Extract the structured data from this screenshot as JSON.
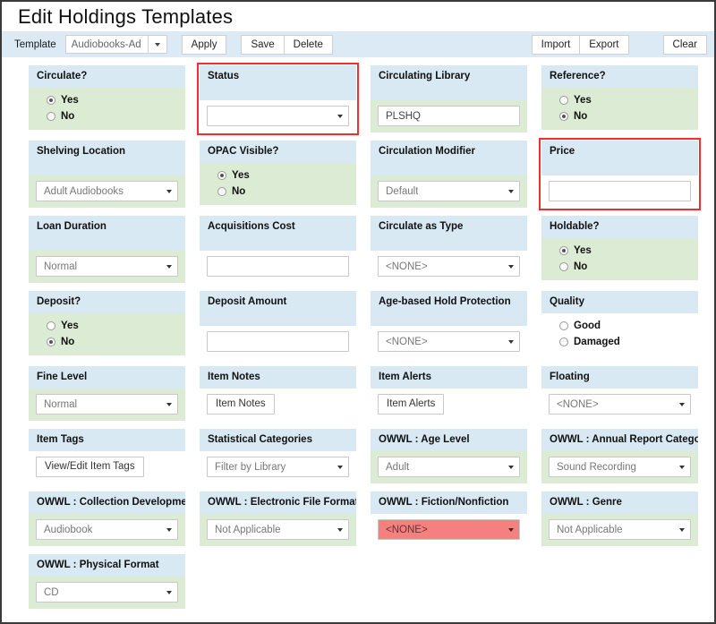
{
  "page": {
    "title": "Edit Holdings Templates"
  },
  "toolbar": {
    "template_label": "Template",
    "template_value": "Audiobooks-Ad",
    "template_caret_icon": "chevron-down-icon",
    "apply_label": "Apply",
    "save_label": "Save",
    "delete_label": "Delete",
    "import_label": "Import",
    "export_label": "Export",
    "clear_label": "Clear"
  },
  "highlight_color": "#f03030",
  "danger_color": "#f48080",
  "header_color": "#d8e9f3",
  "body_green": "#dcecd4",
  "rows": [
    [
      {
        "name": "circulate",
        "label": "Circulate?",
        "type": "radio",
        "body": "green",
        "highlight": false,
        "options": [
          {
            "label": "Yes",
            "selected": true
          },
          {
            "label": "No",
            "selected": false
          }
        ]
      },
      {
        "name": "status",
        "label": "Status",
        "type": "select",
        "body": "white",
        "highlight": true,
        "head_tall": true,
        "value": ""
      },
      {
        "name": "circulating-library",
        "label": "Circulating Library",
        "type": "text",
        "body": "green",
        "highlight": false,
        "head_tall": true,
        "value": "PLSHQ"
      },
      {
        "name": "reference",
        "label": "Reference?",
        "type": "radio",
        "body": "green",
        "highlight": false,
        "options": [
          {
            "label": "Yes",
            "selected": false
          },
          {
            "label": "No",
            "selected": true
          }
        ]
      }
    ],
    [
      {
        "name": "shelving-location",
        "label": "Shelving Location",
        "type": "select",
        "body": "green",
        "highlight": false,
        "head_tall": true,
        "value": "Adult Audiobooks"
      },
      {
        "name": "opac-visible",
        "label": "OPAC Visible?",
        "type": "radio",
        "body": "green",
        "highlight": false,
        "options": [
          {
            "label": "Yes",
            "selected": true
          },
          {
            "label": "No",
            "selected": false
          }
        ]
      },
      {
        "name": "circulation-modifier",
        "label": "Circulation Modifier",
        "type": "select",
        "body": "green",
        "highlight": false,
        "head_tall": true,
        "value": "Default"
      },
      {
        "name": "price",
        "label": "Price",
        "type": "text",
        "body": "white",
        "highlight": true,
        "head_tall": true,
        "value": ""
      }
    ],
    [
      {
        "name": "loan-duration",
        "label": "Loan Duration",
        "type": "select",
        "body": "green",
        "highlight": false,
        "head_tall": true,
        "value": "Normal"
      },
      {
        "name": "acquisitions-cost",
        "label": "Acquisitions Cost",
        "type": "text",
        "body": "white",
        "highlight": false,
        "head_tall": true,
        "value": ""
      },
      {
        "name": "circulate-as-type",
        "label": "Circulate as Type",
        "type": "select",
        "body": "white",
        "highlight": false,
        "head_tall": true,
        "value": "<NONE>"
      },
      {
        "name": "holdable",
        "label": "Holdable?",
        "type": "radio",
        "body": "green",
        "highlight": false,
        "options": [
          {
            "label": "Yes",
            "selected": true
          },
          {
            "label": "No",
            "selected": false
          }
        ]
      }
    ],
    [
      {
        "name": "deposit",
        "label": "Deposit?",
        "type": "radio",
        "body": "green",
        "highlight": false,
        "options": [
          {
            "label": "Yes",
            "selected": false
          },
          {
            "label": "No",
            "selected": true
          }
        ]
      },
      {
        "name": "deposit-amount",
        "label": "Deposit Amount",
        "type": "text",
        "body": "white",
        "highlight": false,
        "head_tall": true,
        "value": ""
      },
      {
        "name": "age-based-hold-protection",
        "label": "Age-based Hold Protection",
        "type": "select",
        "body": "white",
        "highlight": false,
        "head_tall": true,
        "value": "<NONE>"
      },
      {
        "name": "quality",
        "label": "Quality",
        "type": "radio",
        "body": "white",
        "highlight": false,
        "options": [
          {
            "label": "Good",
            "selected": false
          },
          {
            "label": "Damaged",
            "selected": false
          }
        ]
      }
    ],
    [
      {
        "name": "fine-level",
        "label": "Fine Level",
        "type": "select",
        "body": "green",
        "highlight": false,
        "value": "Normal"
      },
      {
        "name": "item-notes",
        "label": "Item Notes",
        "type": "button",
        "body": "white",
        "highlight": false,
        "value": "Item Notes"
      },
      {
        "name": "item-alerts",
        "label": "Item Alerts",
        "type": "button",
        "body": "white",
        "highlight": false,
        "value": "Item Alerts"
      },
      {
        "name": "floating",
        "label": "Floating",
        "type": "select",
        "body": "white",
        "highlight": false,
        "value": "<NONE>"
      }
    ],
    [
      {
        "name": "item-tags",
        "label": "Item Tags",
        "type": "button",
        "body": "white",
        "highlight": false,
        "value": "View/Edit Item Tags"
      },
      {
        "name": "statistical-categories",
        "label": "Statistical Categories",
        "type": "select",
        "body": "white",
        "highlight": false,
        "value": "Filter by Library"
      },
      {
        "name": "owwl-age-level",
        "label": "OWWL : Age Level",
        "type": "select",
        "body": "green",
        "highlight": false,
        "value": "Adult"
      },
      {
        "name": "owwl-annual-report-category",
        "label": "OWWL : Annual Report Category",
        "type": "select",
        "body": "green",
        "highlight": false,
        "value": "Sound Recording"
      }
    ],
    [
      {
        "name": "owwl-collection-development",
        "label": "OWWL : Collection Development",
        "type": "select",
        "body": "green",
        "highlight": false,
        "value": "Audiobook"
      },
      {
        "name": "owwl-electronic-file-format",
        "label": "OWWL : Electronic File Format",
        "type": "select",
        "body": "green",
        "highlight": false,
        "value": "Not Applicable"
      },
      {
        "name": "owwl-fiction-nonfiction",
        "label": "OWWL : Fiction/Nonfiction",
        "type": "select",
        "body": "white",
        "highlight": false,
        "danger": true,
        "value": "<NONE>"
      },
      {
        "name": "owwl-genre",
        "label": "OWWL : Genre",
        "type": "select",
        "body": "green",
        "highlight": false,
        "value": "Not Applicable"
      }
    ],
    [
      {
        "name": "owwl-physical-format",
        "label": "OWWL : Physical Format",
        "type": "select",
        "body": "green",
        "highlight": false,
        "value": "CD"
      }
    ]
  ]
}
